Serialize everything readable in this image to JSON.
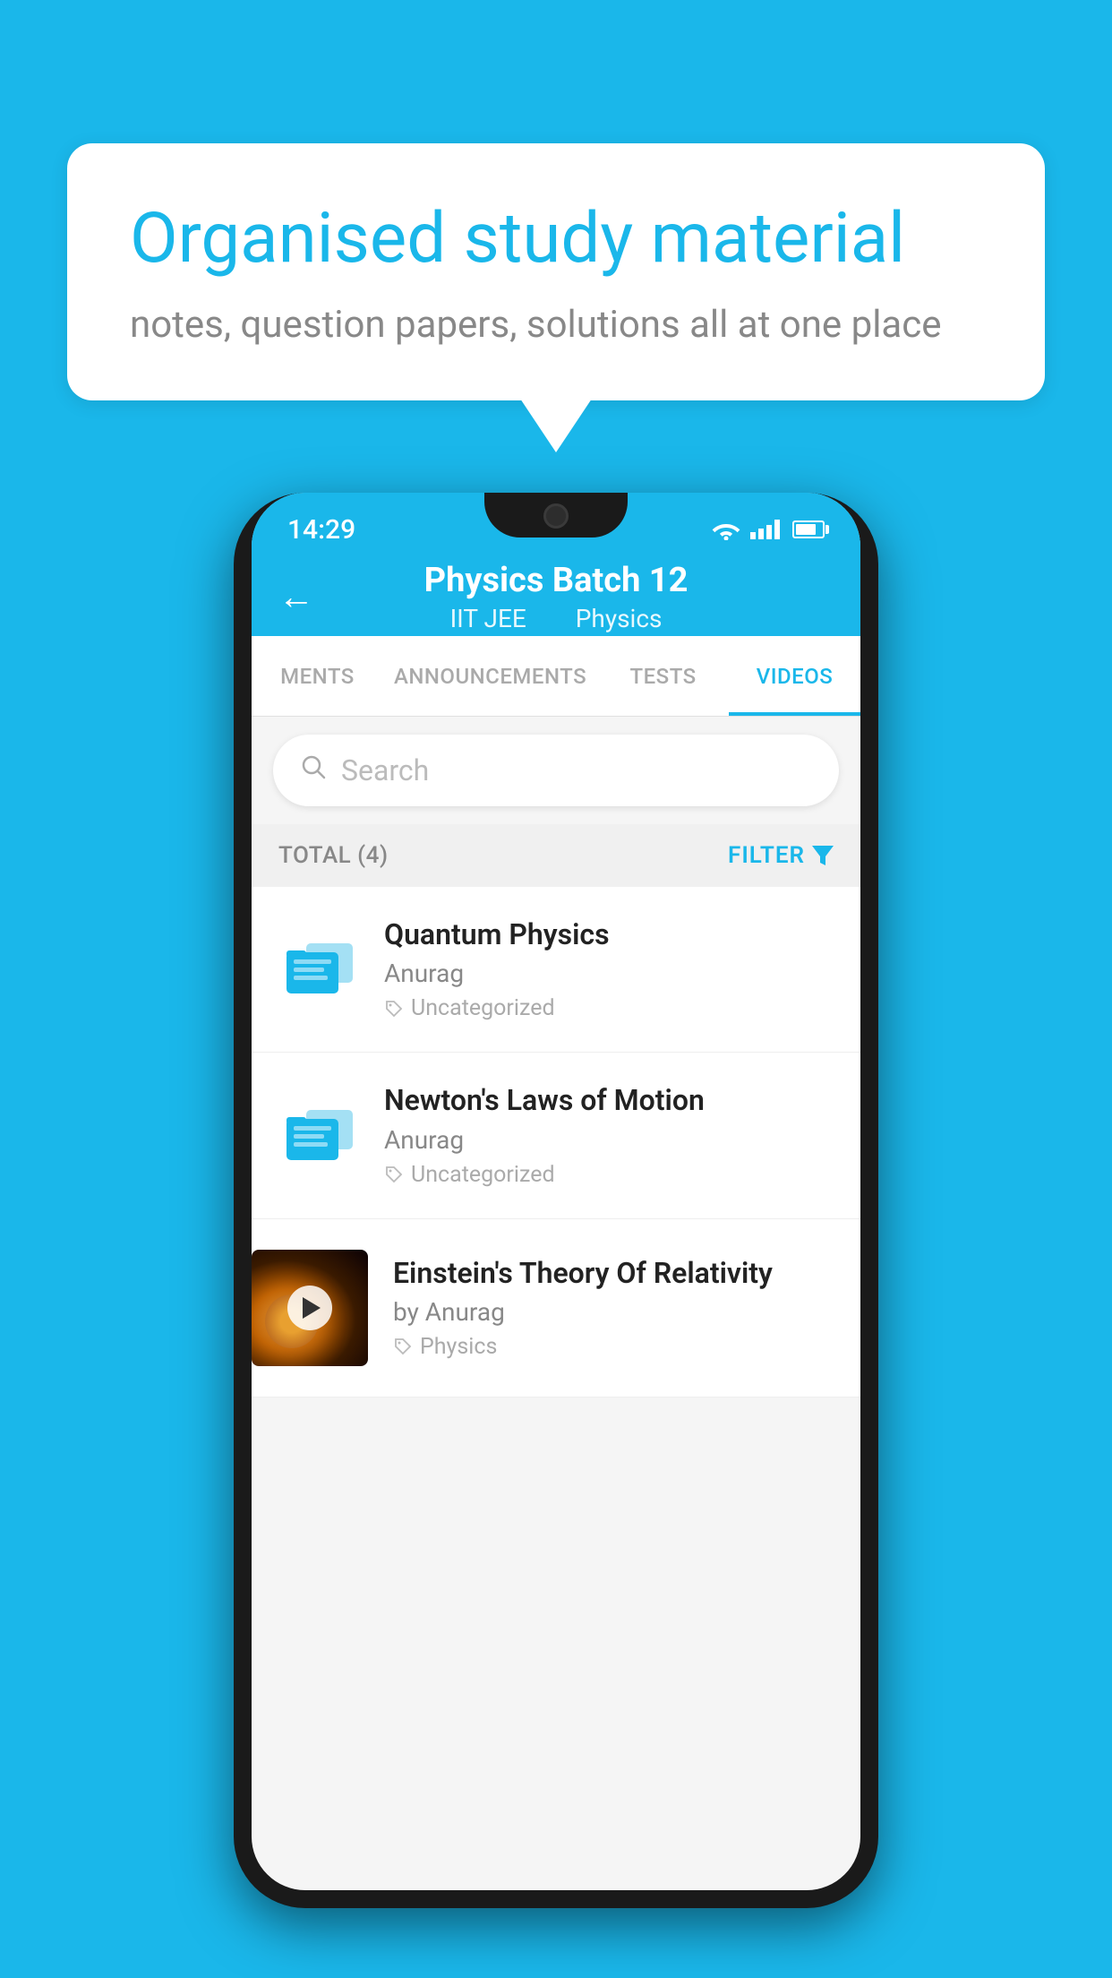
{
  "background_color": "#1ab7ea",
  "speech_bubble": {
    "title": "Organised study material",
    "subtitle": "notes, question papers, solutions all at one place"
  },
  "phone": {
    "status_bar": {
      "time": "14:29"
    },
    "app_bar": {
      "title": "Physics Batch 12",
      "subtitle_parts": [
        "IIT JEE",
        "Physics"
      ],
      "back_arrow": "←"
    },
    "tabs": [
      {
        "label": "MENTS",
        "active": false
      },
      {
        "label": "ANNOUNCEMENTS",
        "active": false
      },
      {
        "label": "TESTS",
        "active": false
      },
      {
        "label": "VIDEOS",
        "active": true
      }
    ],
    "search": {
      "placeholder": "Search"
    },
    "filter_bar": {
      "total_label": "TOTAL (4)",
      "filter_label": "FILTER"
    },
    "videos": [
      {
        "id": "quantum",
        "title": "Quantum Physics",
        "author": "Anurag",
        "tag": "Uncategorized",
        "type": "folder",
        "has_thumbnail": false
      },
      {
        "id": "newton",
        "title": "Newton's Laws of Motion",
        "author": "Anurag",
        "tag": "Uncategorized",
        "type": "folder",
        "has_thumbnail": false
      },
      {
        "id": "einstein",
        "title": "Einstein's Theory Of Relativity",
        "author": "by Anurag",
        "tag": "Physics",
        "type": "video",
        "has_thumbnail": true
      }
    ]
  }
}
